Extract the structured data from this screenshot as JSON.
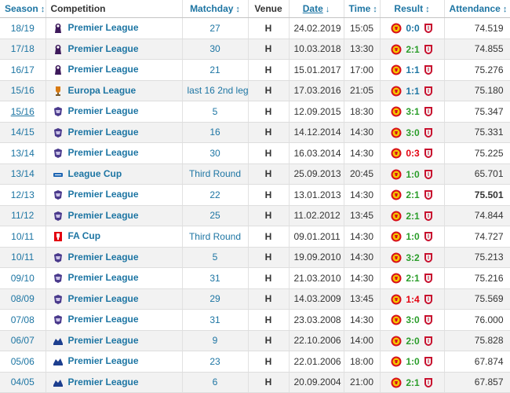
{
  "headers": {
    "season": "Season",
    "competition": "Competition",
    "matchday": "Matchday",
    "venue": "Venue",
    "date": "Date",
    "time": "Time",
    "result": "Result",
    "attendance": "Attendance"
  },
  "sort_icons": {
    "updown": "↕",
    "down": "↓"
  },
  "colors": {
    "link": "#1d75a3",
    "win": "#2a9d2a",
    "draw": "#1d75a3",
    "loss": "#e3000f"
  },
  "rows": [
    {
      "season": "18/19",
      "competition": "Premier League",
      "comp_icon": "premier-league-logo-icon",
      "matchday": "27",
      "venue": "H",
      "date": "24.02.2019",
      "time": "15:05",
      "score": "0:0",
      "outcome": "draw",
      "attendance": "74.519"
    },
    {
      "season": "17/18",
      "competition": "Premier League",
      "comp_icon": "premier-league-logo-icon",
      "matchday": "30",
      "venue": "H",
      "date": "10.03.2018",
      "time": "13:30",
      "score": "2:1",
      "outcome": "win",
      "attendance": "74.855"
    },
    {
      "season": "16/17",
      "competition": "Premier League",
      "comp_icon": "premier-league-logo-icon",
      "matchday": "21",
      "venue": "H",
      "date": "15.01.2017",
      "time": "17:00",
      "score": "1:1",
      "outcome": "draw",
      "attendance": "75.276"
    },
    {
      "season": "15/16",
      "competition": "Europa League",
      "comp_icon": "europa-league-logo-icon",
      "matchday": "last 16 2nd leg",
      "venue": "H",
      "date": "17.03.2016",
      "time": "21:05",
      "score": "1:1",
      "outcome": "draw",
      "attendance": "75.180"
    },
    {
      "season": "15/16",
      "competition": "Premier League",
      "comp_icon": "premier-league-old-logo-icon",
      "matchday": "5",
      "venue": "H",
      "date": "12.09.2015",
      "time": "18:30",
      "score": "3:1",
      "outcome": "win",
      "attendance": "75.347",
      "linked": true
    },
    {
      "season": "14/15",
      "competition": "Premier League",
      "comp_icon": "premier-league-old-logo-icon",
      "matchday": "16",
      "venue": "H",
      "date": "14.12.2014",
      "time": "14:30",
      "score": "3:0",
      "outcome": "win",
      "attendance": "75.331"
    },
    {
      "season": "13/14",
      "competition": "Premier League",
      "comp_icon": "premier-league-old-logo-icon",
      "matchday": "30",
      "venue": "H",
      "date": "16.03.2014",
      "time": "14:30",
      "score": "0:3",
      "outcome": "loss",
      "attendance": "75.225"
    },
    {
      "season": "13/14",
      "competition": "League Cup",
      "comp_icon": "league-cup-logo-icon",
      "matchday": "Third Round",
      "venue": "H",
      "date": "25.09.2013",
      "time": "20:45",
      "score": "1:0",
      "outcome": "win",
      "attendance": "65.701"
    },
    {
      "season": "12/13",
      "competition": "Premier League",
      "comp_icon": "premier-league-old-logo-icon",
      "matchday": "22",
      "venue": "H",
      "date": "13.01.2013",
      "time": "14:30",
      "score": "2:1",
      "outcome": "win",
      "attendance": "75.501",
      "bold": true
    },
    {
      "season": "11/12",
      "competition": "Premier League",
      "comp_icon": "premier-league-old-logo-icon",
      "matchday": "25",
      "venue": "H",
      "date": "11.02.2012",
      "time": "13:45",
      "score": "2:1",
      "outcome": "win",
      "attendance": "74.844"
    },
    {
      "season": "10/11",
      "competition": "FA Cup",
      "comp_icon": "fa-cup-logo-icon",
      "matchday": "Third Round",
      "venue": "H",
      "date": "09.01.2011",
      "time": "14:30",
      "score": "1:0",
      "outcome": "win",
      "attendance": "74.727"
    },
    {
      "season": "10/11",
      "competition": "Premier League",
      "comp_icon": "premier-league-old-logo-icon",
      "matchday": "5",
      "venue": "H",
      "date": "19.09.2010",
      "time": "14:30",
      "score": "3:2",
      "outcome": "win",
      "attendance": "75.213"
    },
    {
      "season": "09/10",
      "competition": "Premier League",
      "comp_icon": "premier-league-old-logo-icon",
      "matchday": "31",
      "venue": "H",
      "date": "21.03.2010",
      "time": "14:30",
      "score": "2:1",
      "outcome": "win",
      "attendance": "75.216"
    },
    {
      "season": "08/09",
      "competition": "Premier League",
      "comp_icon": "premier-league-old-logo-icon",
      "matchday": "29",
      "venue": "H",
      "date": "14.03.2009",
      "time": "13:45",
      "score": "1:4",
      "outcome": "loss",
      "attendance": "75.569"
    },
    {
      "season": "07/08",
      "competition": "Premier League",
      "comp_icon": "premier-league-old-logo-icon",
      "matchday": "31",
      "venue": "H",
      "date": "23.03.2008",
      "time": "14:30",
      "score": "3:0",
      "outcome": "win",
      "attendance": "76.000"
    },
    {
      "season": "06/07",
      "competition": "Premier League",
      "comp_icon": "barclays-premiership-logo-icon",
      "matchday": "9",
      "venue": "H",
      "date": "22.10.2006",
      "time": "14:00",
      "score": "2:0",
      "outcome": "win",
      "attendance": "75.828"
    },
    {
      "season": "05/06",
      "competition": "Premier League",
      "comp_icon": "barclays-premiership-logo-icon",
      "matchday": "23",
      "venue": "H",
      "date": "22.01.2006",
      "time": "18:00",
      "score": "1:0",
      "outcome": "win",
      "attendance": "67.874"
    },
    {
      "season": "04/05",
      "competition": "Premier League",
      "comp_icon": "barclays-premiership-logo-icon",
      "matchday": "6",
      "venue": "H",
      "date": "20.09.2004",
      "time": "21:00",
      "score": "2:1",
      "outcome": "win",
      "attendance": "67.857"
    }
  ]
}
